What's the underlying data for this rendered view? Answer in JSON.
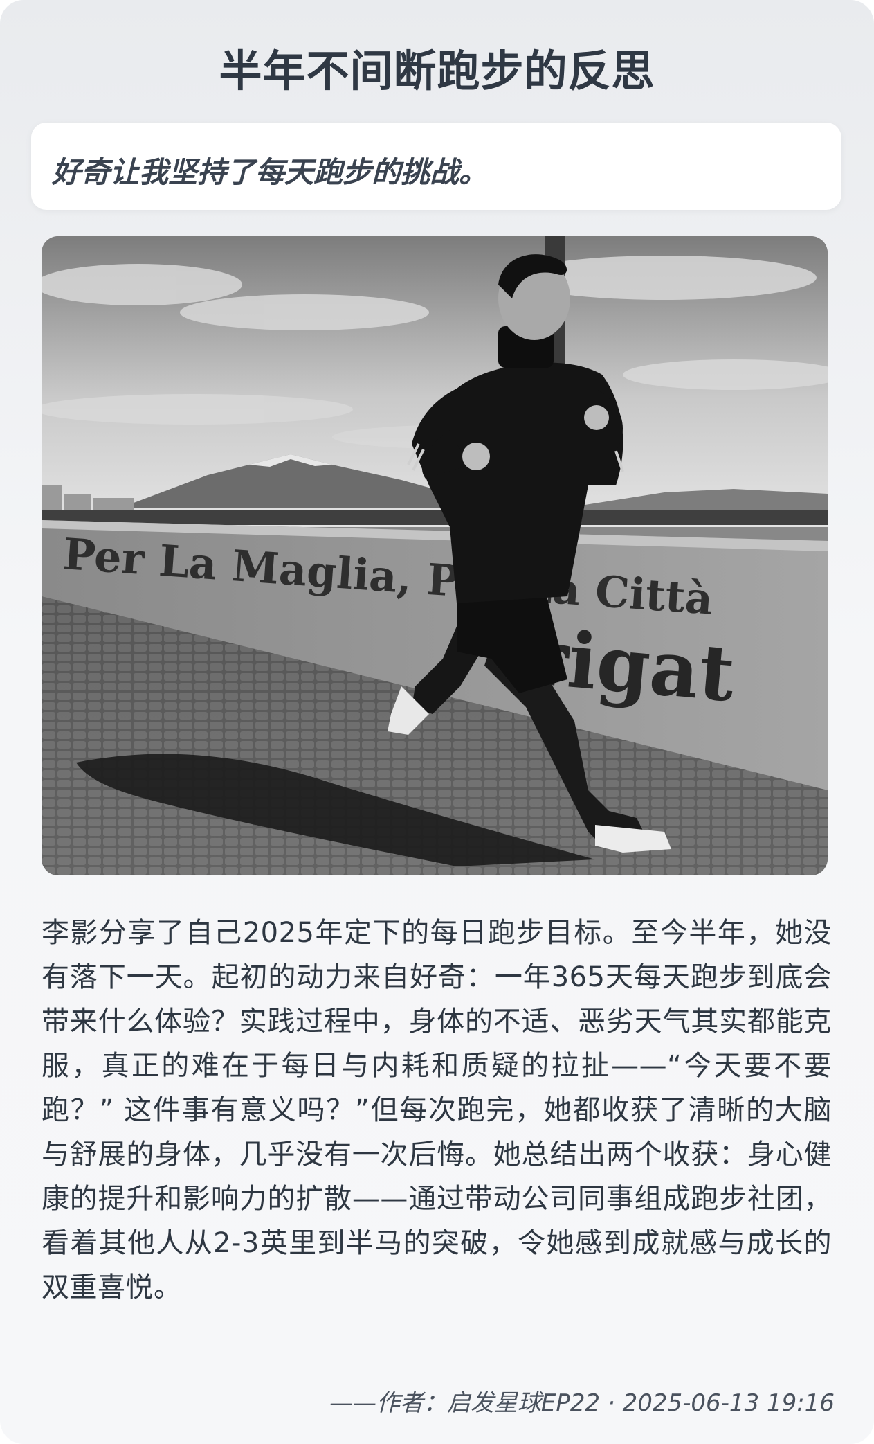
{
  "post": {
    "title": "半年不间断跑步的反思",
    "subtitle": "好奇让我坚持了每天跑步的挑战。",
    "body": "李影分享了自己2025年定下的每日跑步目标。至今半年，她没有落下一天。起初的动力来自好奇：一年365天每天跑步到底会带来什么体验？实践过程中，身体的不适、恶劣天气其实都能克服，真正的难在于每日与内耗和质疑的拉扯——“今天要不要跑？” 这件事有意义吗？”但每次跑完，她都收获了清晰的大脑与舒展的身体，几乎没有一次后悔。她总结出两个收获：身心健康的提升和影响力的扩散——通过带动公司同事组成跑步社团，看着其他人从2-3英里到半马的突破，令她感到成就感与成长的双重喜悦。",
    "footer": "——作者：启发星球EP22 · 2025-06-13 19:16"
  },
  "photo": {
    "wall_graffiti_left": "Per La Maglia, Per La Città",
    "wall_graffiti_right": "rigat"
  }
}
